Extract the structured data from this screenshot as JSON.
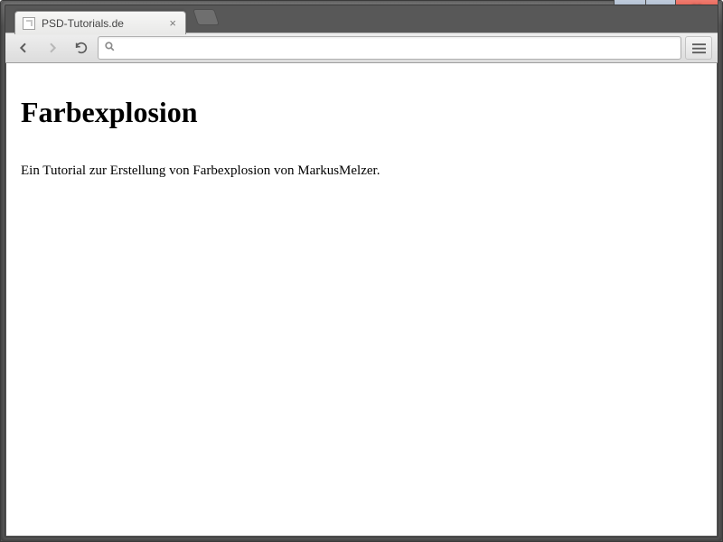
{
  "window": {
    "controls": {
      "minimize": "–",
      "maximize": "□",
      "close": "✕"
    }
  },
  "browser": {
    "tab": {
      "title": "PSD-Tutorials.de",
      "close": "×"
    },
    "omnibox": {
      "value": "",
      "placeholder": ""
    }
  },
  "page": {
    "heading": "Farbexplosion",
    "paragraph": "Ein Tutorial zur Erstellung von Farbexplosion von MarkusMelzer."
  }
}
